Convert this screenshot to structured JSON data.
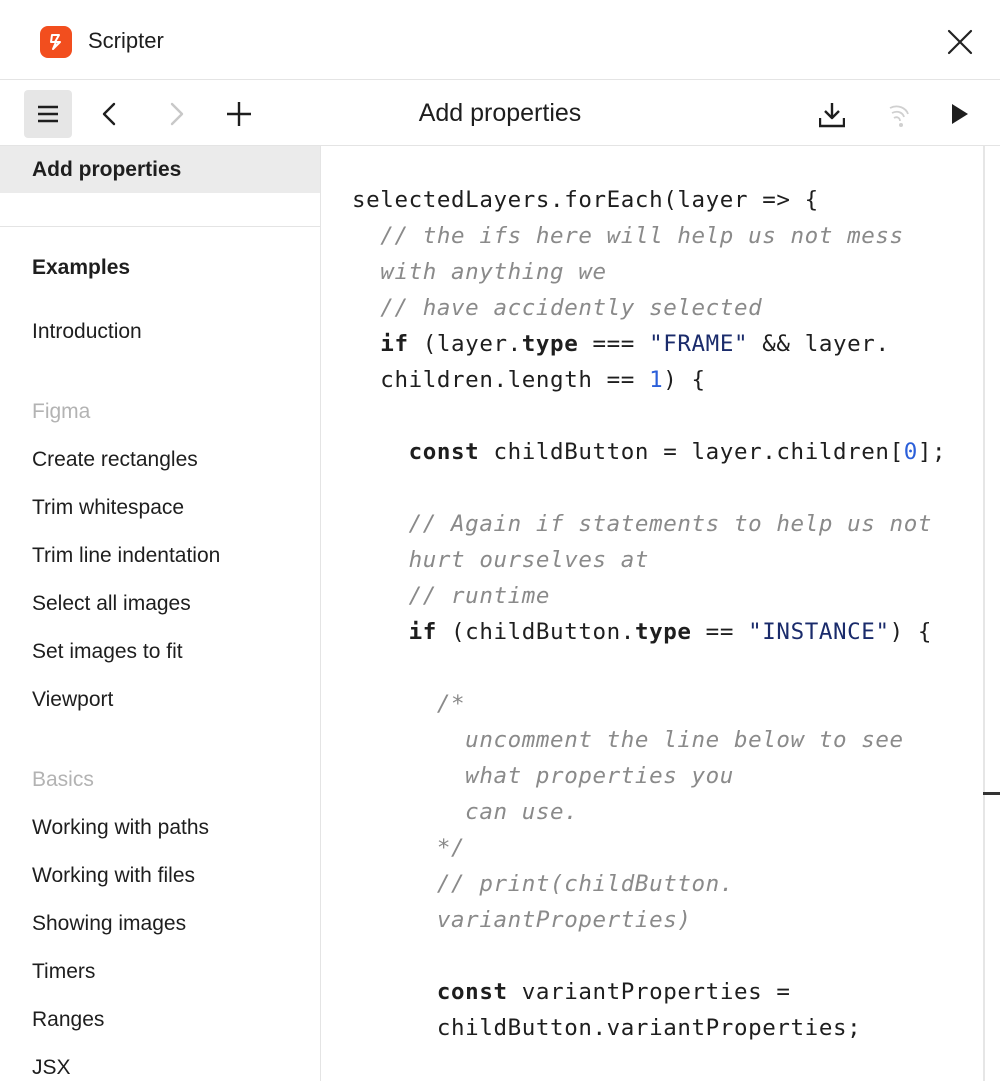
{
  "app": {
    "title": "Scripter",
    "accent": "#f24e1e"
  },
  "toolbar": {
    "title": "Add properties",
    "icons": [
      "menu-icon",
      "chevron-left-icon",
      "chevron-right-icon",
      "plus-icon",
      "download-icon",
      "broadcast-icon",
      "play-icon"
    ]
  },
  "sidebar": {
    "current": "Add properties",
    "groups": [
      {
        "items": [
          "Examples",
          "Introduction"
        ]
      },
      {
        "heading": "Figma",
        "items": [
          "Create rectangles",
          "Trim whitespace",
          "Trim line indentation",
          "Select all images",
          "Set images to fit",
          "Viewport"
        ]
      },
      {
        "heading": "Basics",
        "items": [
          "Working with paths",
          "Working with files",
          "Showing images",
          "Timers",
          "Ranges",
          "JSX"
        ]
      }
    ]
  },
  "code": {
    "lines": [
      "selectedLayers.forEach(layer => {",
      "  // the ifs here will help us not mess",
      "  with anything we",
      "  // have accidently selected",
      "  if (layer.type === \"FRAME\" && layer.",
      "  children.length == 1) {",
      "",
      "    const childButton = layer.children[0];",
      "",
      "    // Again if statements to help us not",
      "    hurt ourselves at",
      "    // runtime",
      "    if (childButton.type == \"INSTANCE\") {",
      "",
      "      /*",
      "        uncomment the line below to see",
      "        what properties you",
      "        can use.",
      "      */",
      "      // print(childButton.",
      "      variantProperties)",
      "",
      "      const variantProperties =",
      "      childButton.variantProperties;"
    ]
  }
}
